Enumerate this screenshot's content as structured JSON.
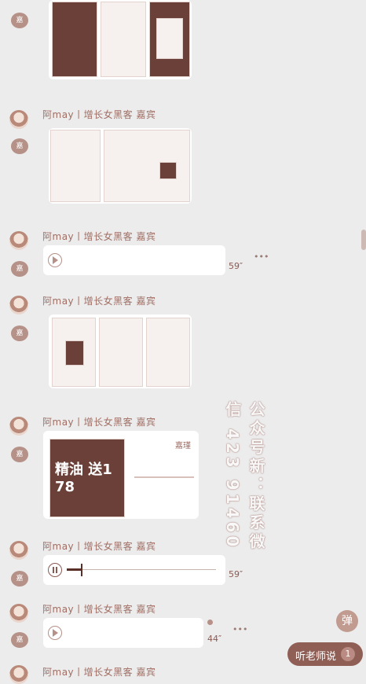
{
  "messages": {
    "sender_name": "阿may丨增长女黑客 嘉宾",
    "voice_1_duration": "59″",
    "voice_2_duration": "59″",
    "voice_3_duration": "44″",
    "more": "•••"
  },
  "image_promo": {
    "headline_overlay": "精油 送1 78",
    "brand": "嘉瑾"
  },
  "watermark": {
    "line1": "公众号新：联系微",
    "line2": "信 423 91460"
  },
  "fab": {
    "danmu_label": "弹",
    "listen_label": "听老师说",
    "listen_count": "1"
  }
}
